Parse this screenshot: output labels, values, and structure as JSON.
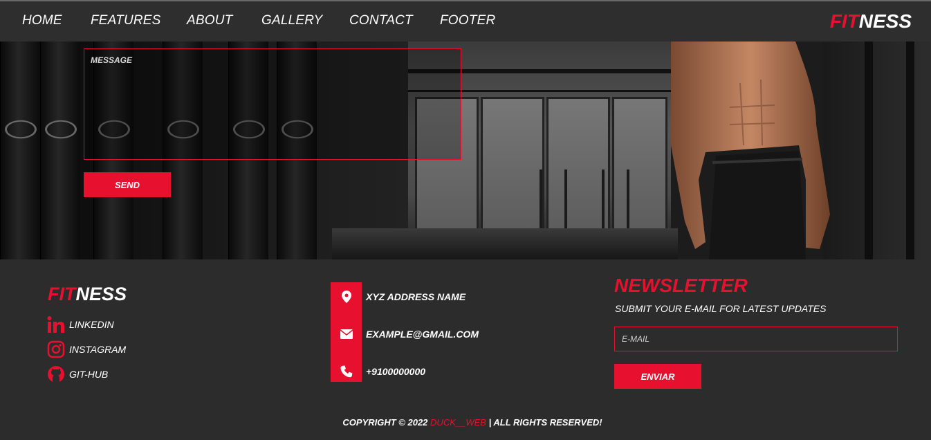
{
  "nav": {
    "links": [
      "HOME",
      "FEATURES",
      "ABOUT",
      "GALLERY",
      "CONTACT",
      "FOOTER"
    ],
    "brand_red": "FIT",
    "brand_white": "NESS"
  },
  "contact_form": {
    "message_label": "MESSAGE",
    "send_label": "SEND"
  },
  "footer": {
    "brand_red": "FIT",
    "brand_white": "NESS",
    "social": [
      {
        "label": "LINKEDIN",
        "icon": "linkedin-icon"
      },
      {
        "label": "INSTAGRAM",
        "icon": "instagram-icon"
      },
      {
        "label": "GIT-HUB",
        "icon": "github-icon"
      }
    ],
    "contact": [
      {
        "text": "XYZ ADDRESS NAME",
        "icon": "location-pin-icon"
      },
      {
        "text": "EXAMPLE@GMAIL.COM",
        "icon": "envelope-icon"
      },
      {
        "text": "+9100000000",
        "icon": "phone-icon"
      }
    ],
    "newsletter": {
      "title": "NEWSLETTER",
      "subtitle": "SUBMIT YOUR E-MAIL FOR LATEST UPDATES",
      "email_placeholder": "E-MAIL",
      "button_label": "ENVIAR"
    },
    "copyright": {
      "prefix": "COPYRIGHT © 2022",
      "author": "DUCK__WEB",
      "suffix": "| ALL RIGHTS RESERVED!"
    }
  },
  "colors": {
    "accent": "#e8102f",
    "background": "#2c2c2c",
    "nav_background": "#2e2e2e"
  }
}
